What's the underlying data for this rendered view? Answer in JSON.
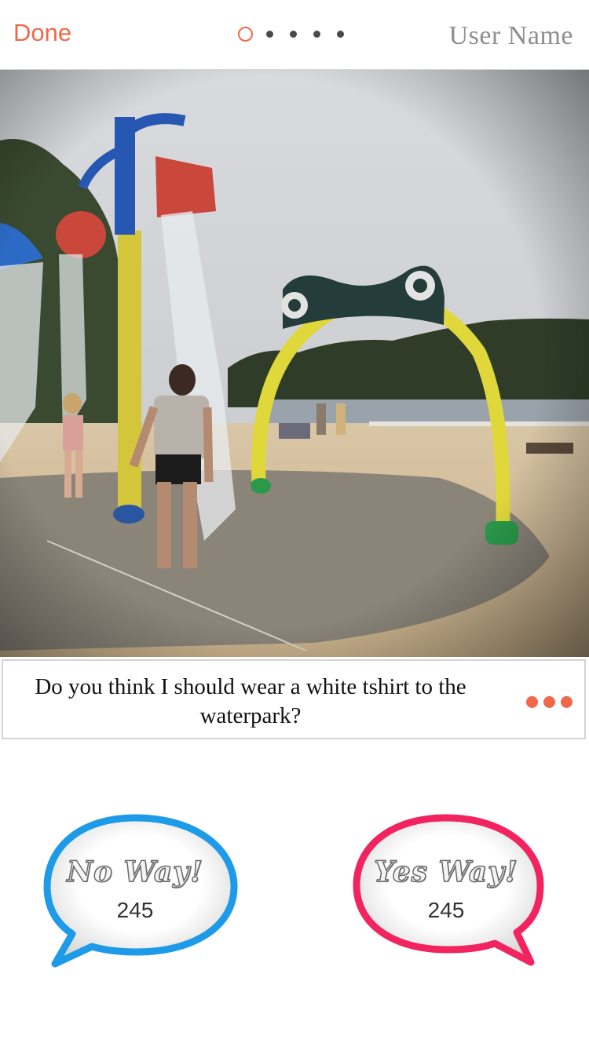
{
  "nav": {
    "done_label": "Done",
    "user_name": "User Name",
    "page_count": 5,
    "current_page": 1
  },
  "post": {
    "question": "Do you think I should wear a white tshirt to the waterpark?"
  },
  "votes": {
    "no": {
      "label": "No Way!",
      "count": "245",
      "color": "#1e9be8"
    },
    "yes": {
      "label": "Yes Way!",
      "count": "245",
      "color": "#f2245f"
    }
  },
  "colors": {
    "accent": "#f0684a"
  },
  "icons": {
    "more": "more-dots-icon"
  }
}
